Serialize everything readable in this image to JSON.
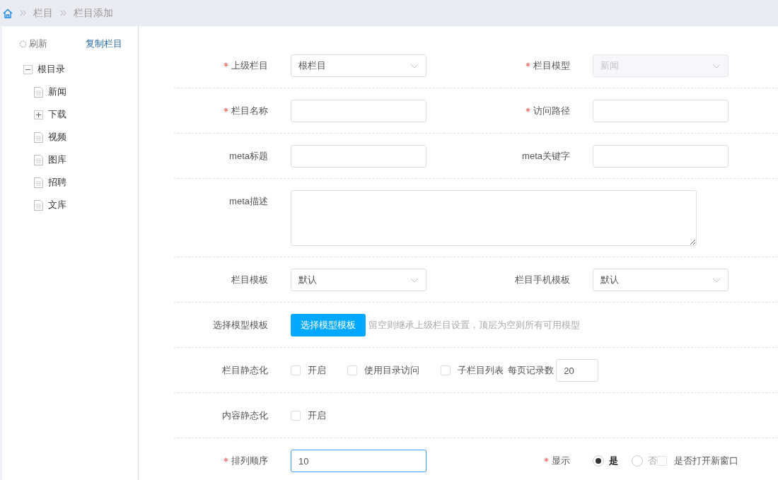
{
  "breadcrumb": [
    {
      "label": "栏目"
    },
    {
      "label": "栏目添加"
    }
  ],
  "sidebar": {
    "refresh": {
      "label": "刷新"
    },
    "copy": {
      "label": "复制栏目"
    },
    "tree": [
      {
        "label": "根目录",
        "kind": "folder",
        "expanded": true,
        "children": [
          {
            "label": "新闻",
            "kind": "page"
          },
          {
            "label": "下载",
            "kind": "folder",
            "expanded": false
          },
          {
            "label": "视频",
            "kind": "page"
          },
          {
            "label": "图库",
            "kind": "page"
          },
          {
            "label": "招聘",
            "kind": "page"
          },
          {
            "label": "文库",
            "kind": "page"
          }
        ]
      }
    ]
  },
  "form": {
    "rows": [
      {
        "fields": [
          {
            "label": "上级栏目",
            "required": true,
            "kind": "select",
            "value": "根栏目",
            "disabled": false
          },
          {
            "label": "栏目模型",
            "required": true,
            "kind": "select",
            "value": "新闻",
            "disabled": true
          }
        ]
      },
      {
        "fields": [
          {
            "label": "栏目名称",
            "required": true,
            "kind": "input",
            "focused": false
          },
          {
            "label": "访问路径",
            "required": true,
            "kind": "input",
            "focused": false
          }
        ]
      },
      {
        "fields": [
          {
            "label": "meta标题",
            "required": false,
            "kind": "input",
            "focused": false
          },
          {
            "label": "meta关键字",
            "required": false,
            "kind": "input",
            "focused": false
          }
        ]
      },
      {
        "fields": [
          {
            "label": "meta描述",
            "required": false,
            "kind": "textarea"
          }
        ]
      },
      {
        "fields": [
          {
            "label": "栏目模板",
            "required": false,
            "kind": "select",
            "value": "默认",
            "disabled": false
          },
          {
            "label": "栏目手机模板",
            "required": false,
            "kind": "select",
            "value": "默认",
            "disabled": false
          }
        ]
      },
      {
        "fields": [
          {
            "label": "选择模型模板",
            "required": false,
            "kind": "button",
            "button": "选择模型模板",
            "hint": "留空则继承上级栏目设置，顶层为空则所有可用模型"
          }
        ]
      },
      {
        "fields": [
          {
            "label": "栏目静态化",
            "required": false,
            "kind": "checks",
            "options": [
              {
                "label": "开启",
                "checked": false
              },
              {
                "label": "使用目录访问",
                "checked": false
              },
              {
                "label": "子栏目列表",
                "checked": false
              }
            ],
            "extra_label": "每页记录数",
            "extra_value": "20"
          }
        ]
      },
      {
        "fields": [
          {
            "label": "内容静态化",
            "required": false,
            "kind": "checks",
            "options": [
              {
                "label": "开启",
                "checked": false
              }
            ]
          }
        ]
      },
      {
        "fields": [
          {
            "label": "排列顺序",
            "required": true,
            "kind": "input",
            "value": "10",
            "focused": true
          },
          {
            "label": "显示",
            "required": true,
            "kind": "radios",
            "options": [
              {
                "label": "是",
                "selected": true
              },
              {
                "label": "否",
                "selected": false
              }
            ],
            "after": {
              "label": "是否打开新窗口",
              "checked": false
            }
          }
        ]
      }
    ]
  }
}
